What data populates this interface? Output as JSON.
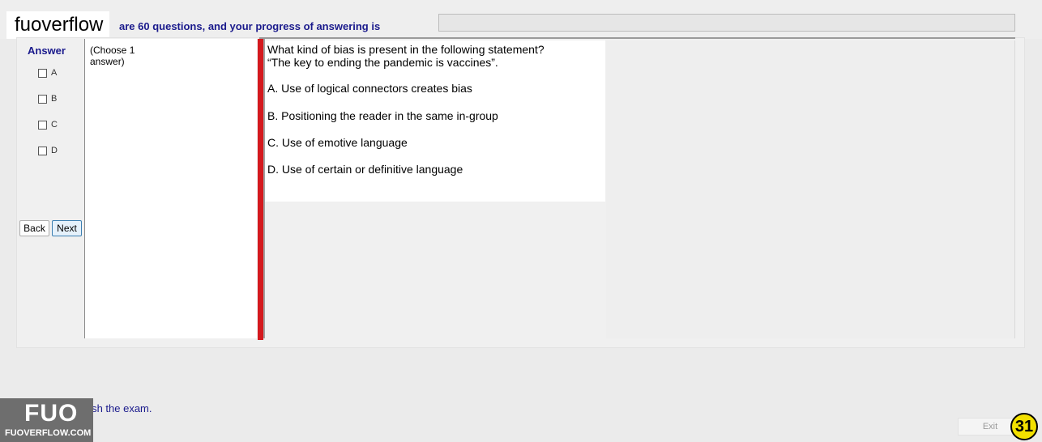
{
  "header": {
    "brand": "fuoverflow",
    "progress_text": "are 60 questions, and your progress of answering is",
    "progress_fraction": 0.0
  },
  "answer_panel": {
    "title": "Answer",
    "options": [
      "A",
      "B",
      "C",
      "D"
    ]
  },
  "nav": {
    "back": "Back",
    "next": "Next"
  },
  "choose": {
    "text": "(Choose 1 answer)"
  },
  "question": {
    "line1": "What kind of bias is present in the following statement?",
    "line2": "“The key to ending the pandemic is vaccines”.",
    "choices": [
      "A.  Use of logical connectors creates bias",
      "B.  Positioning the reader in the same in-group",
      "C.  Use of emotive language",
      "D.  Use of certain or definitive language"
    ]
  },
  "footer": {
    "finish_label": "to finish the exam.",
    "exit": "Exit",
    "badge": "31",
    "logo_big": "FUO",
    "logo_small": "FUOVERFLOW.COM"
  }
}
